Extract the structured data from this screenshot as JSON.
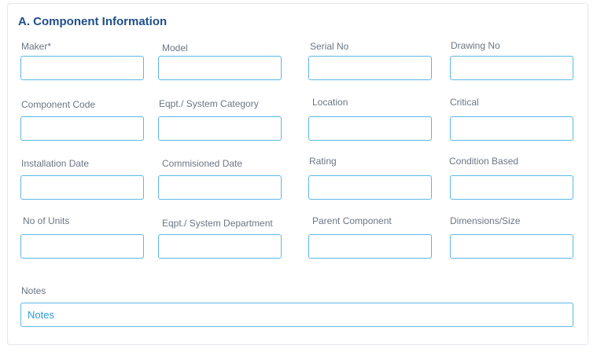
{
  "section": {
    "title": "A. Component Information"
  },
  "fields": {
    "maker": {
      "label": "Maker*",
      "value": ""
    },
    "model": {
      "label": "Model",
      "value": ""
    },
    "serial_no": {
      "label": "Serial No",
      "value": ""
    },
    "drawing_no": {
      "label": "Drawing No",
      "value": ""
    },
    "component_code": {
      "label": "Component Code",
      "value": ""
    },
    "eqpt_system_category": {
      "label": "Eqpt./ System Category",
      "value": ""
    },
    "location": {
      "label": "Location",
      "value": ""
    },
    "critical": {
      "label": "Critical",
      "value": ""
    },
    "installation_date": {
      "label": "Installation Date",
      "value": ""
    },
    "commisioned_date": {
      "label": "Commisioned Date",
      "value": ""
    },
    "rating": {
      "label": "Rating",
      "value": ""
    },
    "condition_based": {
      "label": "Condition Based",
      "value": ""
    },
    "no_of_units": {
      "label": "No of Units",
      "value": ""
    },
    "eqpt_system_department": {
      "label": "Eqpt./ System Department",
      "value": ""
    },
    "parent_component": {
      "label": "Parent Component",
      "value": ""
    },
    "dimensions_size": {
      "label": "Dimensions/Size",
      "value": ""
    },
    "notes": {
      "label": "Notes",
      "value": "",
      "placeholder": "Notes"
    }
  },
  "colors": {
    "title": "#1f4e8a",
    "label": "#6b7683",
    "field_border": "#5cb8e6",
    "placeholder": "#2d9ad8"
  }
}
